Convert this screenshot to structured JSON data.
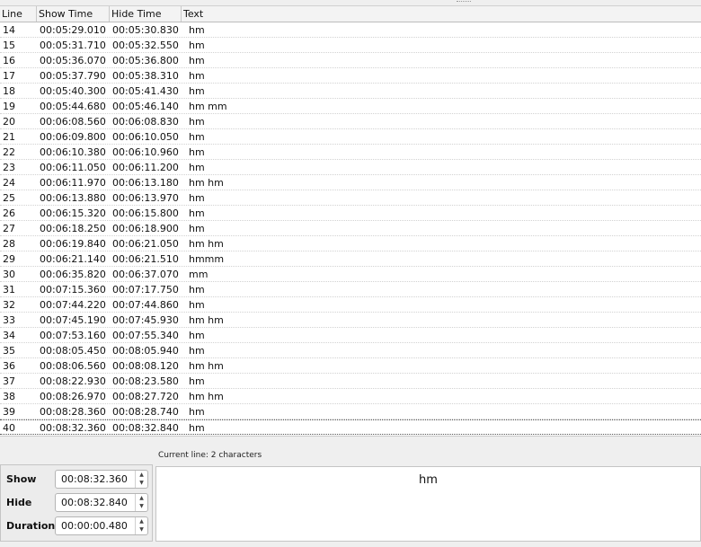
{
  "table": {
    "headers": {
      "line": "Line",
      "show": "Show Time",
      "hide": "Hide Time",
      "text": "Text"
    },
    "current_index": 26,
    "rows": [
      {
        "line": "14",
        "show": "00:05:29.010",
        "hide": "00:05:30.830",
        "text": "hm"
      },
      {
        "line": "15",
        "show": "00:05:31.710",
        "hide": "00:05:32.550",
        "text": "hm"
      },
      {
        "line": "16",
        "show": "00:05:36.070",
        "hide": "00:05:36.800",
        "text": "hm"
      },
      {
        "line": "17",
        "show": "00:05:37.790",
        "hide": "00:05:38.310",
        "text": "hm"
      },
      {
        "line": "18",
        "show": "00:05:40.300",
        "hide": "00:05:41.430",
        "text": "hm"
      },
      {
        "line": "19",
        "show": "00:05:44.680",
        "hide": "00:05:46.140",
        "text": "hm mm"
      },
      {
        "line": "20",
        "show": "00:06:08.560",
        "hide": "00:06:08.830",
        "text": "hm"
      },
      {
        "line": "21",
        "show": "00:06:09.800",
        "hide": "00:06:10.050",
        "text": "hm"
      },
      {
        "line": "22",
        "show": "00:06:10.380",
        "hide": "00:06:10.960",
        "text": "hm"
      },
      {
        "line": "23",
        "show": "00:06:11.050",
        "hide": "00:06:11.200",
        "text": "hm"
      },
      {
        "line": "24",
        "show": "00:06:11.970",
        "hide": "00:06:13.180",
        "text": "hm hm"
      },
      {
        "line": "25",
        "show": "00:06:13.880",
        "hide": "00:06:13.970",
        "text": "hm"
      },
      {
        "line": "26",
        "show": "00:06:15.320",
        "hide": "00:06:15.800",
        "text": "hm"
      },
      {
        "line": "27",
        "show": "00:06:18.250",
        "hide": "00:06:18.900",
        "text": "hm"
      },
      {
        "line": "28",
        "show": "00:06:19.840",
        "hide": "00:06:21.050",
        "text": "hm hm"
      },
      {
        "line": "29",
        "show": "00:06:21.140",
        "hide": "00:06:21.510",
        "text": "hmmm"
      },
      {
        "line": "30",
        "show": "00:06:35.820",
        "hide": "00:06:37.070",
        "text": "mm"
      },
      {
        "line": "31",
        "show": "00:07:15.360",
        "hide": "00:07:17.750",
        "text": "hm"
      },
      {
        "line": "32",
        "show": "00:07:44.220",
        "hide": "00:07:44.860",
        "text": "hm"
      },
      {
        "line": "33",
        "show": "00:07:45.190",
        "hide": "00:07:45.930",
        "text": "hm hm"
      },
      {
        "line": "34",
        "show": "00:07:53.160",
        "hide": "00:07:55.340",
        "text": "hm"
      },
      {
        "line": "35",
        "show": "00:08:05.450",
        "hide": "00:08:05.940",
        "text": "hm"
      },
      {
        "line": "36",
        "show": "00:08:06.560",
        "hide": "00:08:08.120",
        "text": "hm hm"
      },
      {
        "line": "37",
        "show": "00:08:22.930",
        "hide": "00:08:23.580",
        "text": "hm"
      },
      {
        "line": "38",
        "show": "00:08:26.970",
        "hide": "00:08:27.720",
        "text": "hm hm"
      },
      {
        "line": "39",
        "show": "00:08:28.360",
        "hide": "00:08:28.740",
        "text": "hm"
      },
      {
        "line": "40",
        "show": "00:08:32.360",
        "hide": "00:08:32.840",
        "text": "hm"
      }
    ]
  },
  "status": {
    "current_line": "Current line: 2 characters"
  },
  "editor": {
    "show_label": "Show",
    "show_value": "00:08:32.360",
    "hide_label": "Hide",
    "hide_value": "00:08:32.840",
    "duration_label": "Duration",
    "duration_value": "00:00:00.480",
    "preview_text": "hm"
  },
  "icons": {
    "spin_up": "▲",
    "spin_down": "▼"
  }
}
